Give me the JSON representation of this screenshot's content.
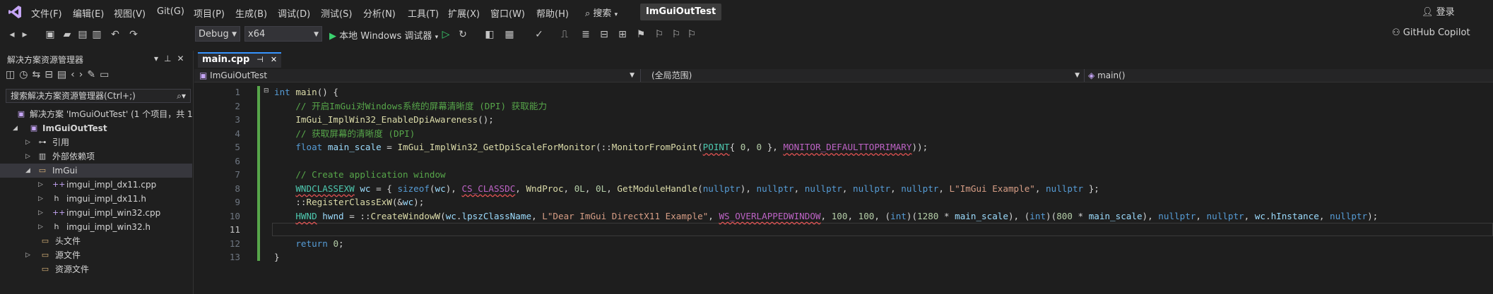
{
  "menu": [
    "文件(F)",
    "编辑(E)",
    "视图(V)",
    "Git(G)",
    "项目(P)",
    "生成(B)",
    "调试(D)",
    "测试(S)",
    "分析(N)",
    "工具(T)",
    "扩展(X)",
    "窗口(W)",
    "帮助(H)"
  ],
  "search_label": "搜索",
  "app_title": "ImGuiOutTest",
  "login_label": "登录",
  "toolbar": {
    "config": "Debug",
    "platform": "x64",
    "debugger_label": "本地 Windows 调试器",
    "copilot_label": "GitHub Copilot"
  },
  "solution_explorer": {
    "title": "解决方案资源管理器",
    "search_placeholder": "搜索解决方案资源管理器(Ctrl+;)",
    "items": [
      {
        "label": "解决方案 'ImGuiOutTest' (1 个项目，共 1",
        "icon": "solution-icon"
      },
      {
        "label": "ImGuiOutTest",
        "icon": "project-icon"
      },
      {
        "label": "引用",
        "icon": "references-icon"
      },
      {
        "label": "外部依赖项",
        "icon": "external-deps-icon"
      },
      {
        "label": "ImGui",
        "icon": "folder-icon"
      },
      {
        "label": "imgui_impl_dx11.cpp",
        "icon": "cpp-file-icon"
      },
      {
        "label": "imgui_impl_dx11.h",
        "icon": "header-file-icon"
      },
      {
        "label": "imgui_impl_win32.cpp",
        "icon": "cpp-file-icon"
      },
      {
        "label": "imgui_impl_win32.h",
        "icon": "header-file-icon"
      },
      {
        "label": "头文件",
        "icon": "folder-icon"
      },
      {
        "label": "源文件",
        "icon": "folder-icon"
      },
      {
        "label": "资源文件",
        "icon": "folder-icon"
      }
    ]
  },
  "editor": {
    "tab_label": "main.cpp",
    "nav_project": "ImGuiOutTest",
    "nav_scope": "(全局范围)",
    "nav_member": "main()",
    "current_line": 11,
    "lines": [
      "int main() {",
      "    // 开启ImGui对Windows系统的屏幕清晰度 (DPI) 获取能力",
      "    ImGui_ImplWin32_EnableDpiAwareness();",
      "    // 获取屏幕的清晰度 (DPI)",
      "    float main_scale = ImGui_ImplWin32_GetDpiScaleForMonitor(::MonitorFromPoint(POINT{ 0, 0 }, MONITOR_DEFAULTTOPRIMARY));",
      "",
      "    // Create application window",
      "    WNDCLASSEXW wc = { sizeof(wc), CS_CLASSDC, WndProc, 0L, 0L, GetModuleHandle(nullptr), nullptr, nullptr, nullptr, nullptr, L\"ImGui Example\", nullptr };",
      "    ::RegisterClassExW(&wc);",
      "    HWND hwnd = ::CreateWindowW(wc.lpszClassName, L\"Dear ImGui DirectX11 Example\", WS_OVERLAPPEDWINDOW, 100, 100, (int)(1280 * main_scale), (int)(800 * main_scale), nullptr, nullptr, wc.hInstance, nullptr);",
      "",
      "    return 0;",
      "}"
    ]
  }
}
